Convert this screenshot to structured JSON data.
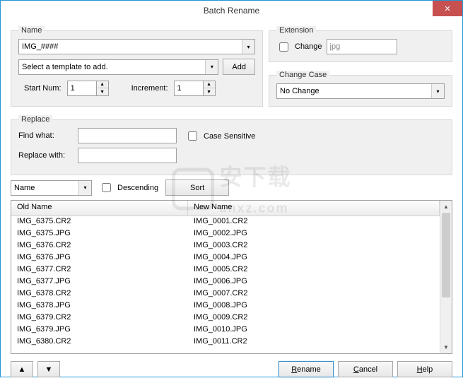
{
  "title": "Batch Rename",
  "name_section": {
    "legend": "Name",
    "pattern": "IMG_####",
    "template_placeholder": "Select a template to add.",
    "add_btn": "Add",
    "start_num_label": "Start Num:",
    "start_num": "1",
    "increment_label": "Increment:",
    "increment": "1"
  },
  "extension_section": {
    "legend": "Extension",
    "change_label": "Change",
    "value": "jpg"
  },
  "case_section": {
    "legend": "Change Case",
    "value": "No Change"
  },
  "replace_section": {
    "legend": "Replace",
    "find_label": "Find what:",
    "replace_label": "Replace with:",
    "case_sensitive_label": "Case Sensitive"
  },
  "sort": {
    "by": "Name",
    "descending_label": "Descending",
    "sort_btn": "Sort"
  },
  "table": {
    "col_old": "Old Name",
    "col_new": "New Name",
    "rows": [
      {
        "old": "IMG_6375.CR2",
        "new": "IMG_0001.CR2"
      },
      {
        "old": "IMG_6375.JPG",
        "new": "IMG_0002.JPG"
      },
      {
        "old": "IMG_6376.CR2",
        "new": "IMG_0003.CR2"
      },
      {
        "old": "IMG_6376.JPG",
        "new": "IMG_0004.JPG"
      },
      {
        "old": "IMG_6377.CR2",
        "new": "IMG_0005.CR2"
      },
      {
        "old": "IMG_6377.JPG",
        "new": "IMG_0006.JPG"
      },
      {
        "old": "IMG_6378.CR2",
        "new": "IMG_0007.CR2"
      },
      {
        "old": "IMG_6378.JPG",
        "new": "IMG_0008.JPG"
      },
      {
        "old": "IMG_6379.CR2",
        "new": "IMG_0009.CR2"
      },
      {
        "old": "IMG_6379.JPG",
        "new": "IMG_0010.JPG"
      },
      {
        "old": "IMG_6380.CR2",
        "new": "IMG_0011.CR2"
      }
    ]
  },
  "buttons": {
    "rename": "Rename",
    "cancel": "Cancel",
    "help": "Help",
    "up": "▲",
    "down": "▼"
  }
}
